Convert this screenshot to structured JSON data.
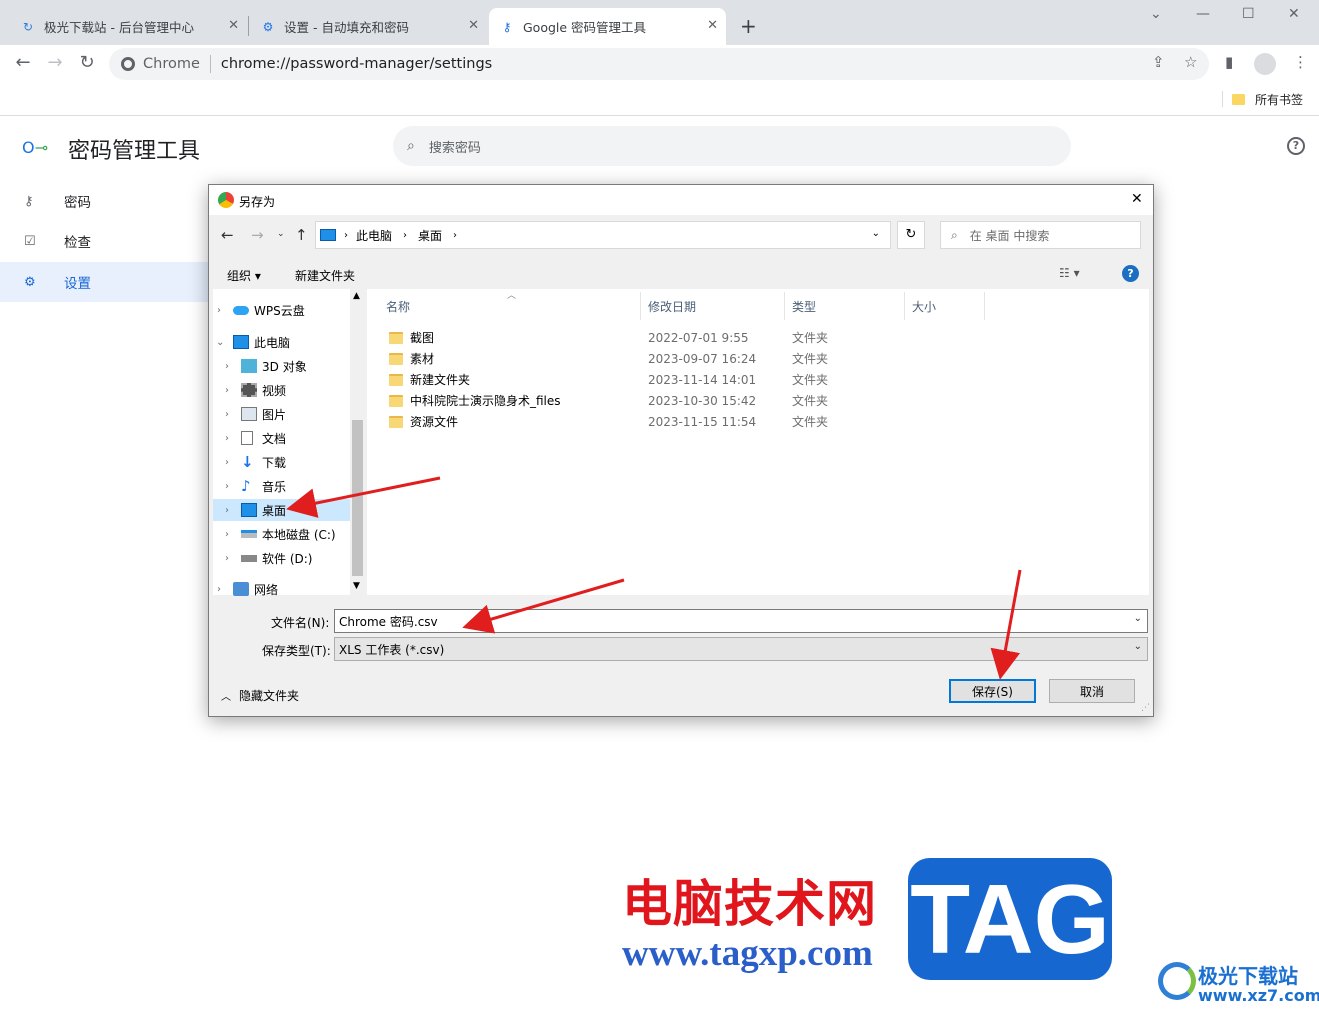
{
  "browser": {
    "tabs": [
      {
        "title": "极光下载站 - 后台管理中心",
        "icon": "jiguang-logo-icon"
      },
      {
        "title": "设置 - 自动填充和密码",
        "icon": "gear-icon"
      },
      {
        "title": "Google 密码管理工具",
        "icon": "key-icon"
      }
    ],
    "omnibox": {
      "site_label": "Chrome",
      "url": "chrome://password-manager/settings"
    },
    "bookmarks_bar": {
      "all_bookmarks": "所有书签"
    }
  },
  "page": {
    "title": "密码管理工具",
    "search_placeholder": "搜索密码",
    "nav": [
      {
        "label": "密码",
        "icon": "key-icon"
      },
      {
        "label": "检查",
        "icon": "checkup-icon"
      },
      {
        "label": "设置",
        "icon": "gear-icon",
        "selected": true
      }
    ]
  },
  "dialog": {
    "title": "另存为",
    "breadcrumb": [
      "此电脑",
      "桌面"
    ],
    "search_placeholder": "在 桌面 中搜索",
    "organize": "组织",
    "new_folder": "新建文件夹",
    "tree": [
      {
        "label": "WPS云盘",
        "level": 0,
        "icon": "cloud-icon"
      },
      {
        "label": "此电脑",
        "level": 0,
        "icon": "pc-icon",
        "expanded": true
      },
      {
        "label": "3D 对象",
        "level": 1,
        "icon": "cube-icon"
      },
      {
        "label": "视频",
        "level": 1,
        "icon": "video-icon"
      },
      {
        "label": "图片",
        "level": 1,
        "icon": "picture-icon"
      },
      {
        "label": "文档",
        "level": 1,
        "icon": "document-icon"
      },
      {
        "label": "下载",
        "level": 1,
        "icon": "download-icon"
      },
      {
        "label": "音乐",
        "level": 1,
        "icon": "music-icon"
      },
      {
        "label": "桌面",
        "level": 1,
        "icon": "desktop-icon",
        "selected": true
      },
      {
        "label": "本地磁盘 (C:)",
        "level": 1,
        "icon": "drive-c-icon"
      },
      {
        "label": "软件 (D:)",
        "level": 1,
        "icon": "drive-d-icon"
      },
      {
        "label": "网络",
        "level": 0,
        "icon": "network-icon"
      }
    ],
    "columns": [
      "名称",
      "修改日期",
      "类型",
      "大小"
    ],
    "files": [
      {
        "name": "截图",
        "date": "2022-07-01 9:55",
        "type": "文件夹"
      },
      {
        "name": "素材",
        "date": "2023-09-07 16:24",
        "type": "文件夹"
      },
      {
        "name": "新建文件夹",
        "date": "2023-11-14 14:01",
        "type": "文件夹"
      },
      {
        "name": "中科院院士演示隐身术_files",
        "date": "2023-10-30 15:42",
        "type": "文件夹"
      },
      {
        "name": "资源文件",
        "date": "2023-11-15 11:54",
        "type": "文件夹"
      }
    ],
    "filename_label": "文件名(N):",
    "filename_value": "Chrome 密码.csv",
    "filetype_label": "保存类型(T):",
    "filetype_value": "XLS 工作表 (*.csv)",
    "hide_folders": "隐藏文件夹",
    "save": "保存(S)",
    "cancel": "取消"
  },
  "watermark": {
    "cn": "电脑技术网",
    "url": "www.tagxp.com",
    "tag": "TAG",
    "brand": "极光下载站",
    "brand_url": "www.xz7.com"
  }
}
